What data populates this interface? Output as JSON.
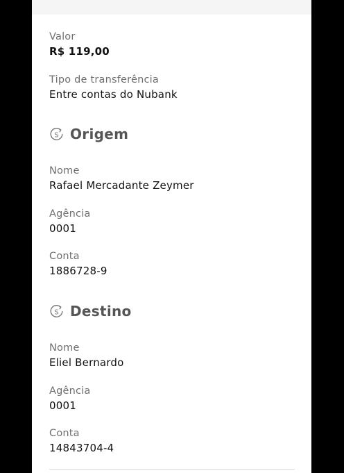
{
  "transfer": {
    "valor_label": "Valor",
    "valor_value": "R$ 119,00",
    "tipo_label": "Tipo de transferência",
    "tipo_value": "Entre contas do Nubank"
  },
  "origem": {
    "title": "Origem",
    "icon": "money-transfer-icon",
    "nome_label": "Nome",
    "nome_value": "Rafael Mercadante Zeymer",
    "agencia_label": "Agência",
    "agencia_value": "0001",
    "conta_label": "Conta",
    "conta_value": "1886728-9"
  },
  "destino": {
    "title": "Destino",
    "icon": "money-transfer-icon",
    "nome_label": "Nome",
    "nome_value": "Eliel Bernardo",
    "agencia_label": "Agência",
    "agencia_value": "0001",
    "conta_label": "Conta",
    "conta_value": "14843704-4"
  },
  "colors": {
    "background": "#ffffff",
    "outside": "#000000",
    "label": "#6f6f6f",
    "value": "#111111",
    "section_title": "#555555"
  }
}
